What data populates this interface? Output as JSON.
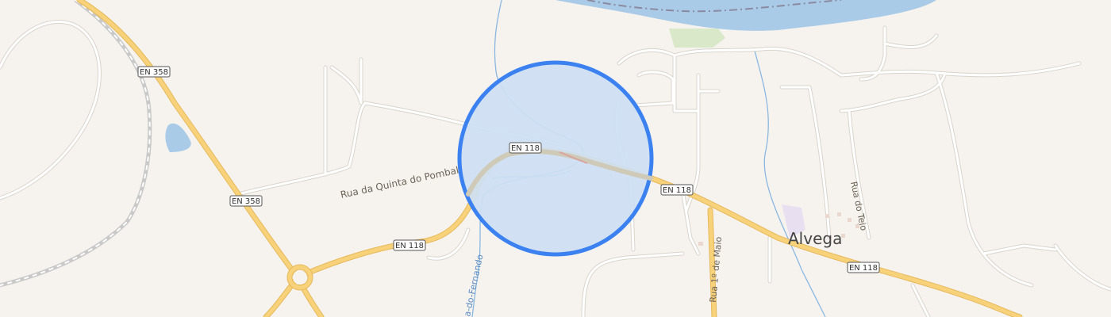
{
  "map": {
    "place_label": "Alvega",
    "streets": {
      "quinta_pombal": "Rua da Quinta do Pombal",
      "tejo": "Rua do Tejo",
      "primeiro_maio": "Rua 1º de Maio",
      "ribeira": "a-do-Fernando"
    },
    "road_shields": {
      "en358_top": "EN 358",
      "en358_mid": "EN 358",
      "en118_circle": "EN 118",
      "en118_right": "EN 118",
      "en118_bottom_left": "EN 118",
      "en118_bottom_right": "EN 118"
    },
    "colors": {
      "background": "#f6f3ef",
      "water": "#aacbe8",
      "major_road": "#f7d27a",
      "minor_road": "#ffffff",
      "highlight_fill": "#cddff3",
      "highlight_stroke": "#3b82f0",
      "park": "#d8e8c8"
    }
  }
}
